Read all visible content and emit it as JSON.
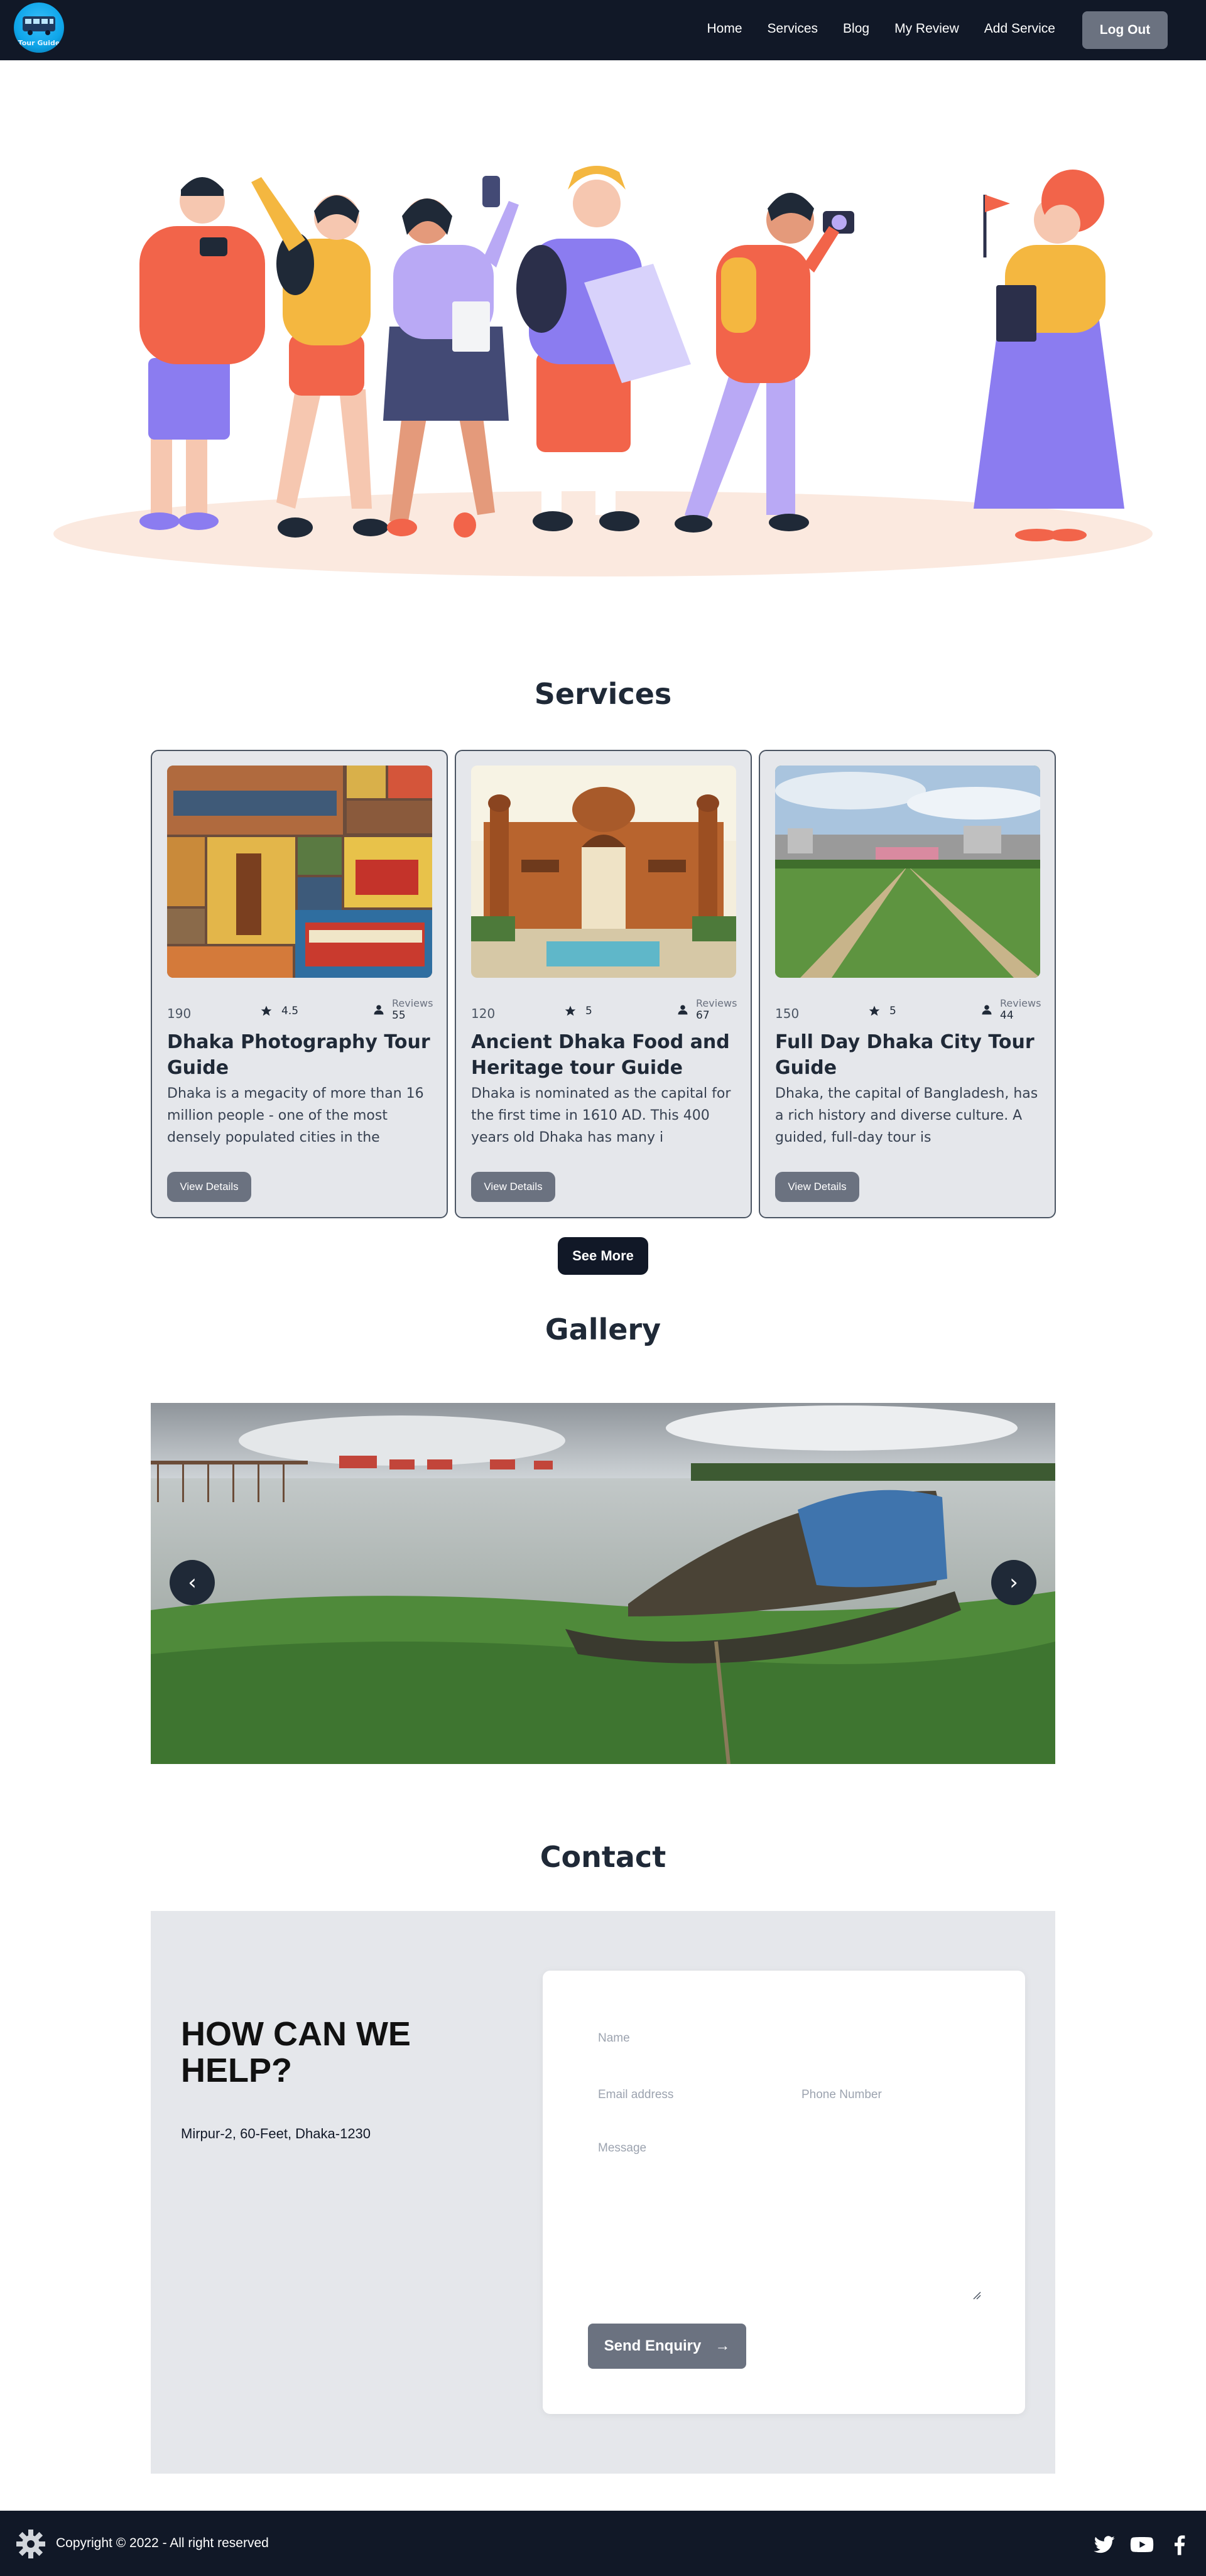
{
  "brand": {
    "logo_text": "Tour Guide"
  },
  "nav": {
    "links": [
      "Home",
      "Services",
      "Blog",
      "My Review",
      "Add Service"
    ],
    "logout_label": "Log Out"
  },
  "services": {
    "title": "Services",
    "reviews_label": "Reviews",
    "details_label": "View Details",
    "items": [
      {
        "price": "190",
        "rating": "4.5",
        "reviews": "55",
        "title": "Dhaka Photography Tour Guide",
        "description": "Dhaka is a megacity of more than 16 million people - one of the most densely populated cities in the"
      },
      {
        "price": "120",
        "rating": "5",
        "reviews": "67",
        "title": "Ancient Dhaka Food and Heritage tour Guide",
        "description": "Dhaka is nominated as the capital for the first time in 1610 AD. This 400 years old Dhaka has many i"
      },
      {
        "price": "150",
        "rating": "5",
        "reviews": "44",
        "title": "Full Day Dhaka City Tour Guide",
        "description": "Dhaka, the capital of Bangladesh, has a rich history and diverse culture. A guided, full-day tour is"
      }
    ],
    "see_more_label": "See More"
  },
  "gallery": {
    "title": "Gallery",
    "prev_label": "‹",
    "next_label": "›"
  },
  "contact": {
    "title": "Contact",
    "help_title": "HOW CAN WE HELP?",
    "address": "Mirpur-2, 60-Feet, Dhaka-1230",
    "name_placeholder": "Name",
    "email_placeholder": "Email address",
    "phone_placeholder": "Phone Number",
    "message_placeholder": "Message",
    "send_label": "Send Enquiry",
    "send_arrow": "→"
  },
  "footer": {
    "copyright": "Copyright © 2022 - All right reserved",
    "social_icons": [
      "twitter-icon",
      "youtube-icon",
      "facebook-icon"
    ]
  },
  "colors": {
    "navbar": "#111827",
    "button_gray": "#6b7280",
    "card_bg": "#e5e7eb"
  }
}
